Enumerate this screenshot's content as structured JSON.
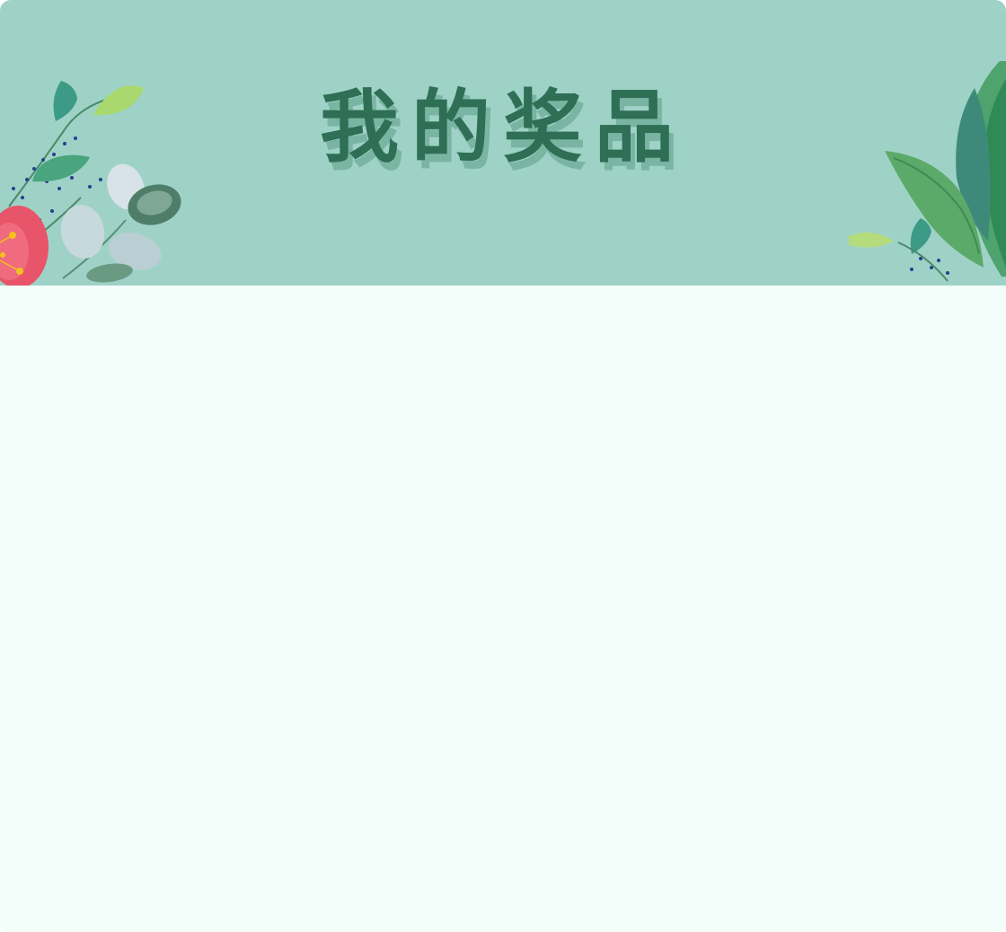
{
  "header": {
    "title": "我的奖品"
  },
  "prize_list": {
    "items": []
  },
  "colors": {
    "banner_background": "#9fd2c6",
    "page_background": "#f3fdf9",
    "title_color": "#2e6f55",
    "title_shadow": "#4e9178"
  },
  "decorations": {
    "left": "floral-leaves-decoration",
    "right": "tropical-leaves-decoration"
  }
}
